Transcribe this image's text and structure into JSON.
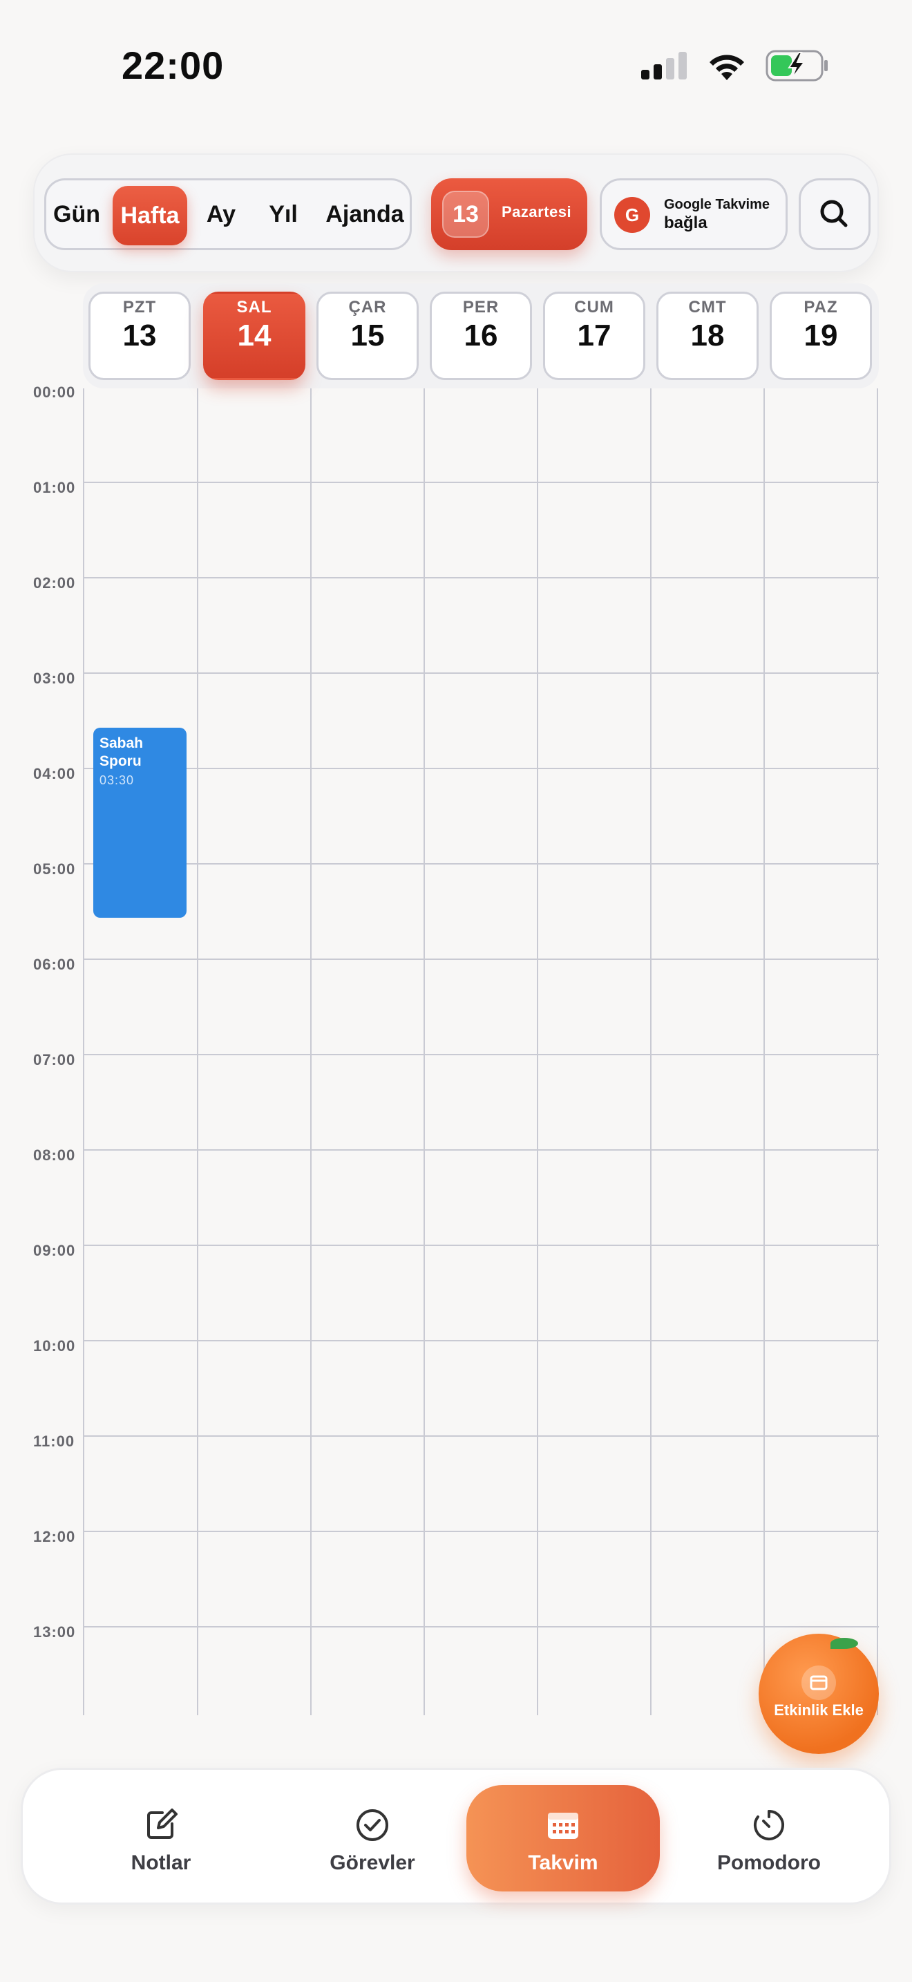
{
  "status_bar": {
    "time": "22:00"
  },
  "toolbar": {
    "views": [
      "Gün",
      "Hafta",
      "Ay",
      "Yıl",
      "Ajanda"
    ],
    "active_view": "Hafta",
    "today": {
      "day": "13",
      "label": "Pazartesi"
    },
    "google": {
      "title": "Google Takvime",
      "subtitle": "bağla",
      "icon_letter": "G"
    }
  },
  "week_days": [
    {
      "name": "PZT",
      "date": "13"
    },
    {
      "name": "SAL",
      "date": "14",
      "active": true
    },
    {
      "name": "ÇAR",
      "date": "15"
    },
    {
      "name": "PER",
      "date": "16"
    },
    {
      "name": "CUM",
      "date": "17"
    },
    {
      "name": "CMT",
      "date": "18"
    },
    {
      "name": "PAZ",
      "date": "19"
    }
  ],
  "hours": [
    "00:00",
    "01:00",
    "02:00",
    "03:00",
    "04:00",
    "05:00",
    "06:00",
    "07:00",
    "08:00",
    "09:00",
    "10:00",
    "11:00",
    "12:00",
    "13:00"
  ],
  "events": [
    {
      "title": "Sabah Sporu",
      "time": "03:30",
      "day": "PZT",
      "color": "#2f89e3"
    }
  ],
  "fab": {
    "label": "Etkinlik Ekle"
  },
  "tabbar": {
    "items": [
      {
        "label": "Notlar",
        "icon": "note-edit-icon"
      },
      {
        "label": "Görevler",
        "icon": "check-circle-icon"
      },
      {
        "label": "Takvim",
        "icon": "calendar-icon",
        "active": true
      },
      {
        "label": "Pomodoro",
        "icon": "timer-icon"
      }
    ]
  },
  "colors": {
    "accent": "#e0482f",
    "event": "#2f89e3",
    "tab_active": "#ef7a48",
    "fab": "#f0711f"
  }
}
